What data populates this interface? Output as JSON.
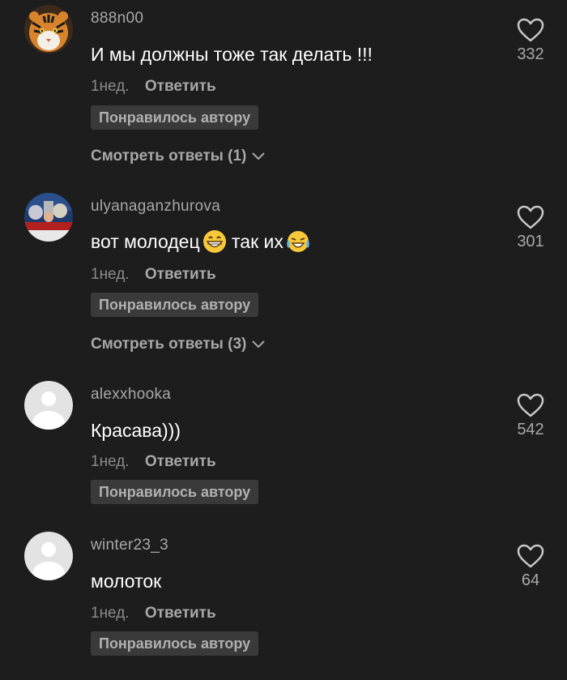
{
  "comments": [
    {
      "username": "888n00",
      "avatar": "tiger-avatar",
      "text": "И мы должны тоже так делать !!!",
      "time": "1нед.",
      "reply_label": "Ответить",
      "liked_badge": "Понравилось автору",
      "view_replies": "Смотреть ответы (1)",
      "likes": "332"
    },
    {
      "username": "ulyanaganzhurova",
      "avatar": "photo-avatar",
      "text_part1": "вот молодец",
      "emoji1": "grinning-face-emoji",
      "text_part2": " так их",
      "emoji2": "tears-of-joy-emoji",
      "time": "1нед.",
      "reply_label": "Ответить",
      "liked_badge": "Понравилось автору",
      "view_replies": "Смотреть ответы (3)",
      "likes": "301"
    },
    {
      "username": "alexxhooka",
      "avatar": "default-avatar",
      "text": "Красава)))",
      "time": "1нед.",
      "reply_label": "Ответить",
      "liked_badge": "Понравилось автору",
      "likes": "542"
    },
    {
      "username": "winter23_3",
      "avatar": "default-avatar",
      "text": "молоток",
      "time": "1нед.",
      "reply_label": "Ответить",
      "liked_badge": "Понравилось автору",
      "likes": "64"
    }
  ],
  "colors": {
    "background": "#1d1d1d",
    "primary_text": "#ffffff",
    "secondary_text": "#a8a8a8",
    "badge_bg": "#3a3a3a"
  }
}
